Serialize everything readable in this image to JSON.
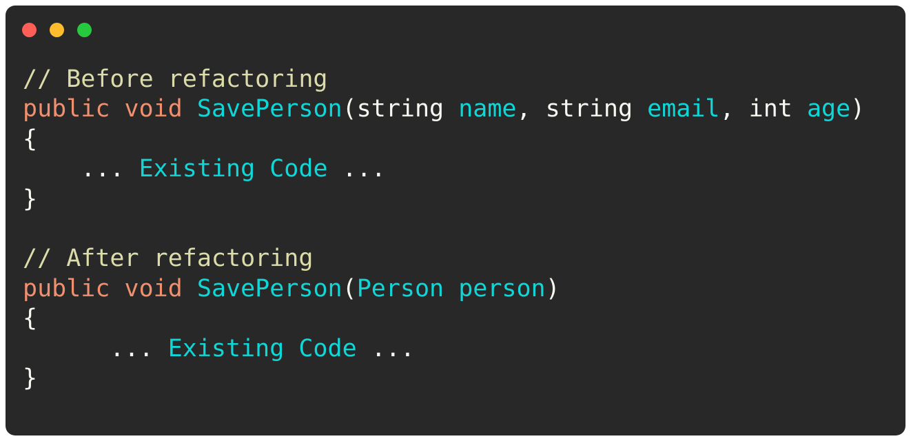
{
  "window": {
    "background_color": "#282828",
    "page_background_color": "#ffffff",
    "corner_radius_px": 14,
    "controls": [
      {
        "name": "close",
        "color": "#ff5f56"
      },
      {
        "name": "minimize",
        "color": "#ffbd2e"
      },
      {
        "name": "zoom",
        "color": "#27c93f"
      }
    ]
  },
  "theme": {
    "comment_color": "#dcdcaa",
    "keyword_color": "#f0906f",
    "identifier_color": "#0fd7d7",
    "plain_color": "#f8f8f2",
    "font_size_px": 35,
    "line_height_px": 43.4
  },
  "code": {
    "language": "csharp",
    "lines": [
      {
        "index": 1,
        "text": "// Before refactoring",
        "tokens": [
          {
            "t": "// Before refactoring",
            "c": "comment"
          }
        ]
      },
      {
        "index": 2,
        "text": "public void SavePerson(string name, string email, int age)",
        "tokens": [
          {
            "t": "public",
            "c": "keyword"
          },
          {
            "t": " ",
            "c": "plain"
          },
          {
            "t": "void",
            "c": "keyword"
          },
          {
            "t": " ",
            "c": "plain"
          },
          {
            "t": "SavePerson",
            "c": "ident"
          },
          {
            "t": "(string ",
            "c": "plain"
          },
          {
            "t": "name",
            "c": "ident"
          },
          {
            "t": ", string ",
            "c": "plain"
          },
          {
            "t": "email",
            "c": "ident"
          },
          {
            "t": ", int ",
            "c": "plain"
          },
          {
            "t": "age",
            "c": "ident"
          },
          {
            "t": ")",
            "c": "plain"
          }
        ]
      },
      {
        "index": 3,
        "text": "{",
        "tokens": [
          {
            "t": "{",
            "c": "plain"
          }
        ]
      },
      {
        "index": 4,
        "text": "    ... Existing Code ...",
        "tokens": [
          {
            "t": "    ... ",
            "c": "plain"
          },
          {
            "t": "Existing Code",
            "c": "ident"
          },
          {
            "t": " ...",
            "c": "plain"
          }
        ]
      },
      {
        "index": 5,
        "text": "}",
        "tokens": [
          {
            "t": "}",
            "c": "plain"
          }
        ]
      },
      {
        "index": 6,
        "text": "",
        "tokens": []
      },
      {
        "index": 7,
        "text": "// After refactoring",
        "tokens": [
          {
            "t": "// After refactoring",
            "c": "comment"
          }
        ]
      },
      {
        "index": 8,
        "text": "public void SavePerson(Person person)",
        "tokens": [
          {
            "t": "public",
            "c": "keyword"
          },
          {
            "t": " ",
            "c": "plain"
          },
          {
            "t": "void",
            "c": "keyword"
          },
          {
            "t": " ",
            "c": "plain"
          },
          {
            "t": "SavePerson",
            "c": "ident"
          },
          {
            "t": "(",
            "c": "plain"
          },
          {
            "t": "Person person",
            "c": "ident"
          },
          {
            "t": ")",
            "c": "plain"
          }
        ]
      },
      {
        "index": 9,
        "text": "{",
        "tokens": [
          {
            "t": "{",
            "c": "plain"
          }
        ]
      },
      {
        "index": 10,
        "text": "      ... Existing Code ...",
        "tokens": [
          {
            "t": "      ... ",
            "c": "plain"
          },
          {
            "t": "Existing Code",
            "c": "ident"
          },
          {
            "t": " ...",
            "c": "plain"
          }
        ]
      },
      {
        "index": 11,
        "text": "}",
        "tokens": [
          {
            "t": "}",
            "c": "plain"
          }
        ]
      }
    ]
  }
}
